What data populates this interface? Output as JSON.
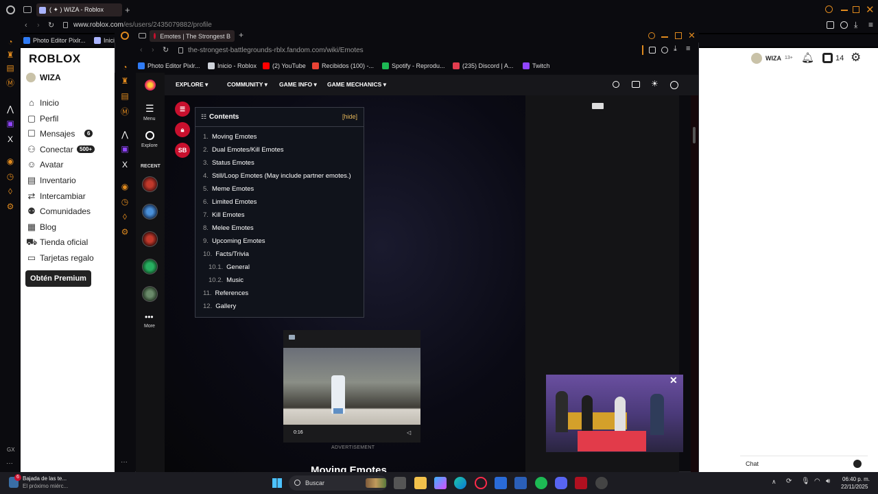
{
  "back_window": {
    "tab_title": "( ✦ ) WIZA - Roblox",
    "url_host": "www.roblox.com",
    "url_path": "/es/users/2435079882/profile",
    "bookmarks": [
      "Photo Editor Pixlr...",
      "Inici"
    ]
  },
  "roblox": {
    "logo": "ROBLOX",
    "username": "WIZA",
    "header_username": "WIZA",
    "age_badge": "13+",
    "robux": "14",
    "nav": [
      {
        "label": "Inicio",
        "icon": "home-icon"
      },
      {
        "label": "Perfil",
        "icon": "profile-icon"
      },
      {
        "label": "Mensajes",
        "icon": "messages-icon",
        "badge": "6"
      },
      {
        "label": "Conectar",
        "icon": "connect-icon",
        "badge": "500+"
      },
      {
        "label": "Avatar",
        "icon": "avatar-icon"
      },
      {
        "label": "Inventario",
        "icon": "inventory-icon"
      },
      {
        "label": "Intercambiar",
        "icon": "trade-icon"
      },
      {
        "label": "Comunidades",
        "icon": "communities-icon"
      },
      {
        "label": "Blog",
        "icon": "blog-icon"
      },
      {
        "label": "Tienda oficial",
        "icon": "store-icon"
      },
      {
        "label": "Tarjetas regalo",
        "icon": "giftcard-icon"
      }
    ],
    "premium_button": "Obtén Premium",
    "chat_label": "Chat"
  },
  "front_window": {
    "tab_title": "Emotes | The Strongest B",
    "url_host": "the-strongest-battlegrounds-rblx.fandom.com",
    "url_path": "/wiki/Emotes",
    "bookmarks": [
      {
        "label": "Photo Editor Pixlr...",
        "color": "#2f7bf5"
      },
      {
        "label": "Inicio - Roblox",
        "color": "#cfd3da"
      },
      {
        "label": "(2) YouTube",
        "color": "#ff0000"
      },
      {
        "label": "Recibidos (100) -...",
        "color": "#ea4335"
      },
      {
        "label": "Spotify - Reprodu...",
        "color": "#1db954"
      },
      {
        "label": "(235) Discord | A...",
        "color": "#e33d4f"
      },
      {
        "label": "Twitch",
        "color": "#9146ff"
      }
    ]
  },
  "fandom": {
    "menu_label": "Menu",
    "explore_label": "Explore",
    "recent_label": "RECENT",
    "more_label": "More",
    "sb_label": "SB",
    "nav": [
      "EXPLORE",
      "COMMUNITY",
      "GAME INFO",
      "GAME MECHANICS"
    ],
    "toc_title": "Contents",
    "toc_hide": "[hide]",
    "toc": [
      {
        "num": "1.",
        "label": "Moving Emotes",
        "level": 1
      },
      {
        "num": "2.",
        "label": "Dual Emotes/Kill Emotes",
        "level": 1
      },
      {
        "num": "3.",
        "label": "Status Emotes",
        "level": 1
      },
      {
        "num": "4.",
        "label": "Still/Loop Emotes (May include partner emotes.)",
        "level": 1
      },
      {
        "num": "5.",
        "label": "Meme Emotes",
        "level": 1
      },
      {
        "num": "6.",
        "label": "Limited Emotes",
        "level": 1
      },
      {
        "num": "7.",
        "label": "Kill Emotes",
        "level": 1
      },
      {
        "num": "8.",
        "label": "Melee Emotes",
        "level": 1
      },
      {
        "num": "9.",
        "label": "Upcoming Emotes",
        "level": 1
      },
      {
        "num": "10.",
        "label": "Facts/Trivia",
        "level": 1
      },
      {
        "num": "10.1.",
        "label": "General",
        "level": 2
      },
      {
        "num": "10.2.",
        "label": "Music",
        "level": 2
      },
      {
        "num": "11.",
        "label": "References",
        "level": 1
      },
      {
        "num": "12.",
        "label": "Gallery",
        "level": 1
      }
    ],
    "ad_time": "0:16",
    "ad_label": "ADVERTISEMENT",
    "section_heading": "Moving Emotes",
    "gx_label": "GX"
  },
  "taskbar": {
    "notif_count": "6",
    "notif_title": "Bajada de las te...",
    "notif_sub": "El próximo miérc...",
    "search_placeholder": "Buscar",
    "time": "06:40 p. m.",
    "date": "22/11/2025"
  }
}
